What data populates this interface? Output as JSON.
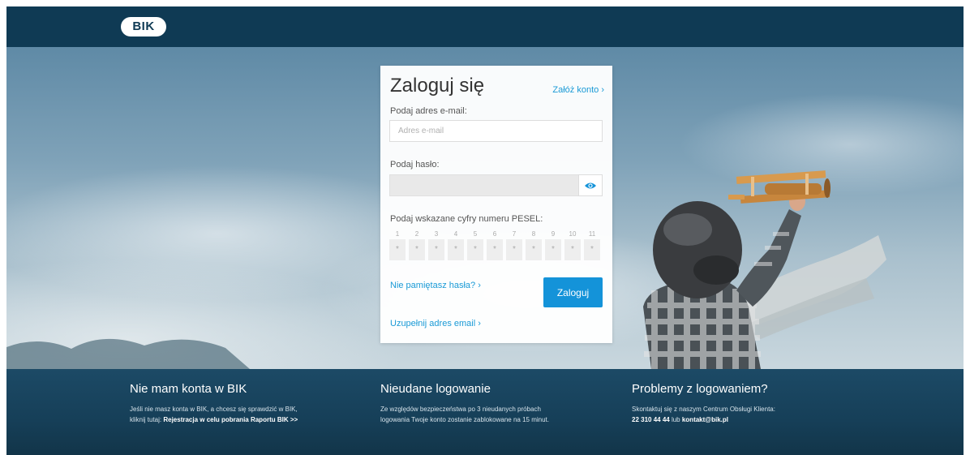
{
  "header": {
    "logo_text": "BIK"
  },
  "login": {
    "title": "Zaloguj się",
    "register_link": "Załóż konto ›",
    "email_label": "Podaj adres e-mail:",
    "email_placeholder": "Adres e-mail",
    "email_value": "",
    "password_label": "Podaj hasło:",
    "pesel_label": "Podaj wskazane cyfry numeru PESEL:",
    "pesel_positions": [
      "1",
      "2",
      "3",
      "4",
      "5",
      "6",
      "7",
      "8",
      "9",
      "10",
      "11"
    ],
    "pesel_mask": "*",
    "forgot_link": "Nie pamiętasz hasła? ›",
    "submit_label": "Zaloguj",
    "fill_email_link": "Uzupełnij adres email ›"
  },
  "footer": {
    "col1": {
      "title": "Nie mam konta w BIK",
      "text_line1": "Jeśli nie masz konta w BIK, a chcesz się sprawdzić w BIK,",
      "text_prefix": "kliknij tutaj: ",
      "link": "Rejestracja w celu pobrania Raportu BIK >>"
    },
    "col2": {
      "title": "Nieudane logowanie",
      "text_line1": "Ze względów bezpieczeństwa po 3 nieudanych próbach",
      "text_line2": "logowania Twoje konto zostanie zablokowane na 15 minut."
    },
    "col3": {
      "title": "Problemy z logowaniem?",
      "text_line1": "Skontaktuj się z naszym Centrum Obsługi Klienta:",
      "phone": "22 310 44 44",
      "or_text": " lub ",
      "email": "kontakt@bik.pl"
    }
  },
  "colors": {
    "header_bg": "#0f3a54",
    "accent": "#1493d9",
    "link": "#1a9ad6",
    "footer_bg": "#163f58"
  },
  "icons": {
    "password_toggle": "eye-icon"
  }
}
